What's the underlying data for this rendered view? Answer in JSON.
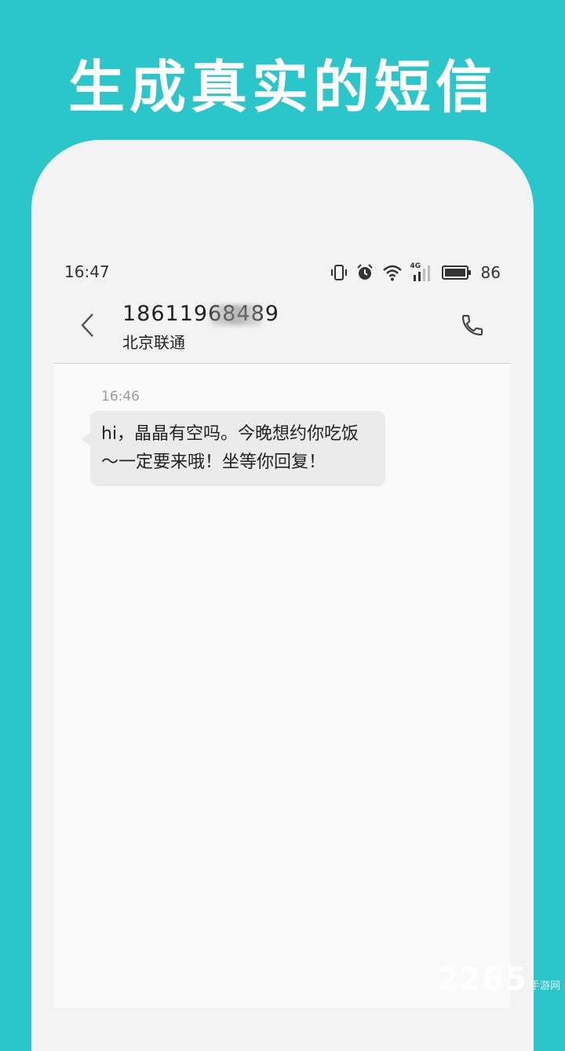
{
  "promo": {
    "title": "生成真实的短信"
  },
  "status_bar": {
    "time": "16:47",
    "icons": [
      "vibrate-icon",
      "alarm-icon",
      "wifi-icon",
      "signal-4g-icon",
      "battery-icon"
    ],
    "network_label": "4G",
    "battery_level": "86"
  },
  "header": {
    "contact_number": "18611968489",
    "carrier": "北京联通",
    "back_icon": "chevron-left-icon",
    "call_icon": "phone-icon"
  },
  "messages": [
    {
      "time": "16:46",
      "text": "hi，晶晶有空吗。今晚想约你吃饭～一定要来哦！坐等你回复！"
    }
  ],
  "watermark": {
    "number": "2265",
    "sub": "手游网"
  },
  "colors": {
    "background": "#2bc6c9",
    "phone": "#f3f3f3",
    "bubble": "#ebebeb"
  }
}
